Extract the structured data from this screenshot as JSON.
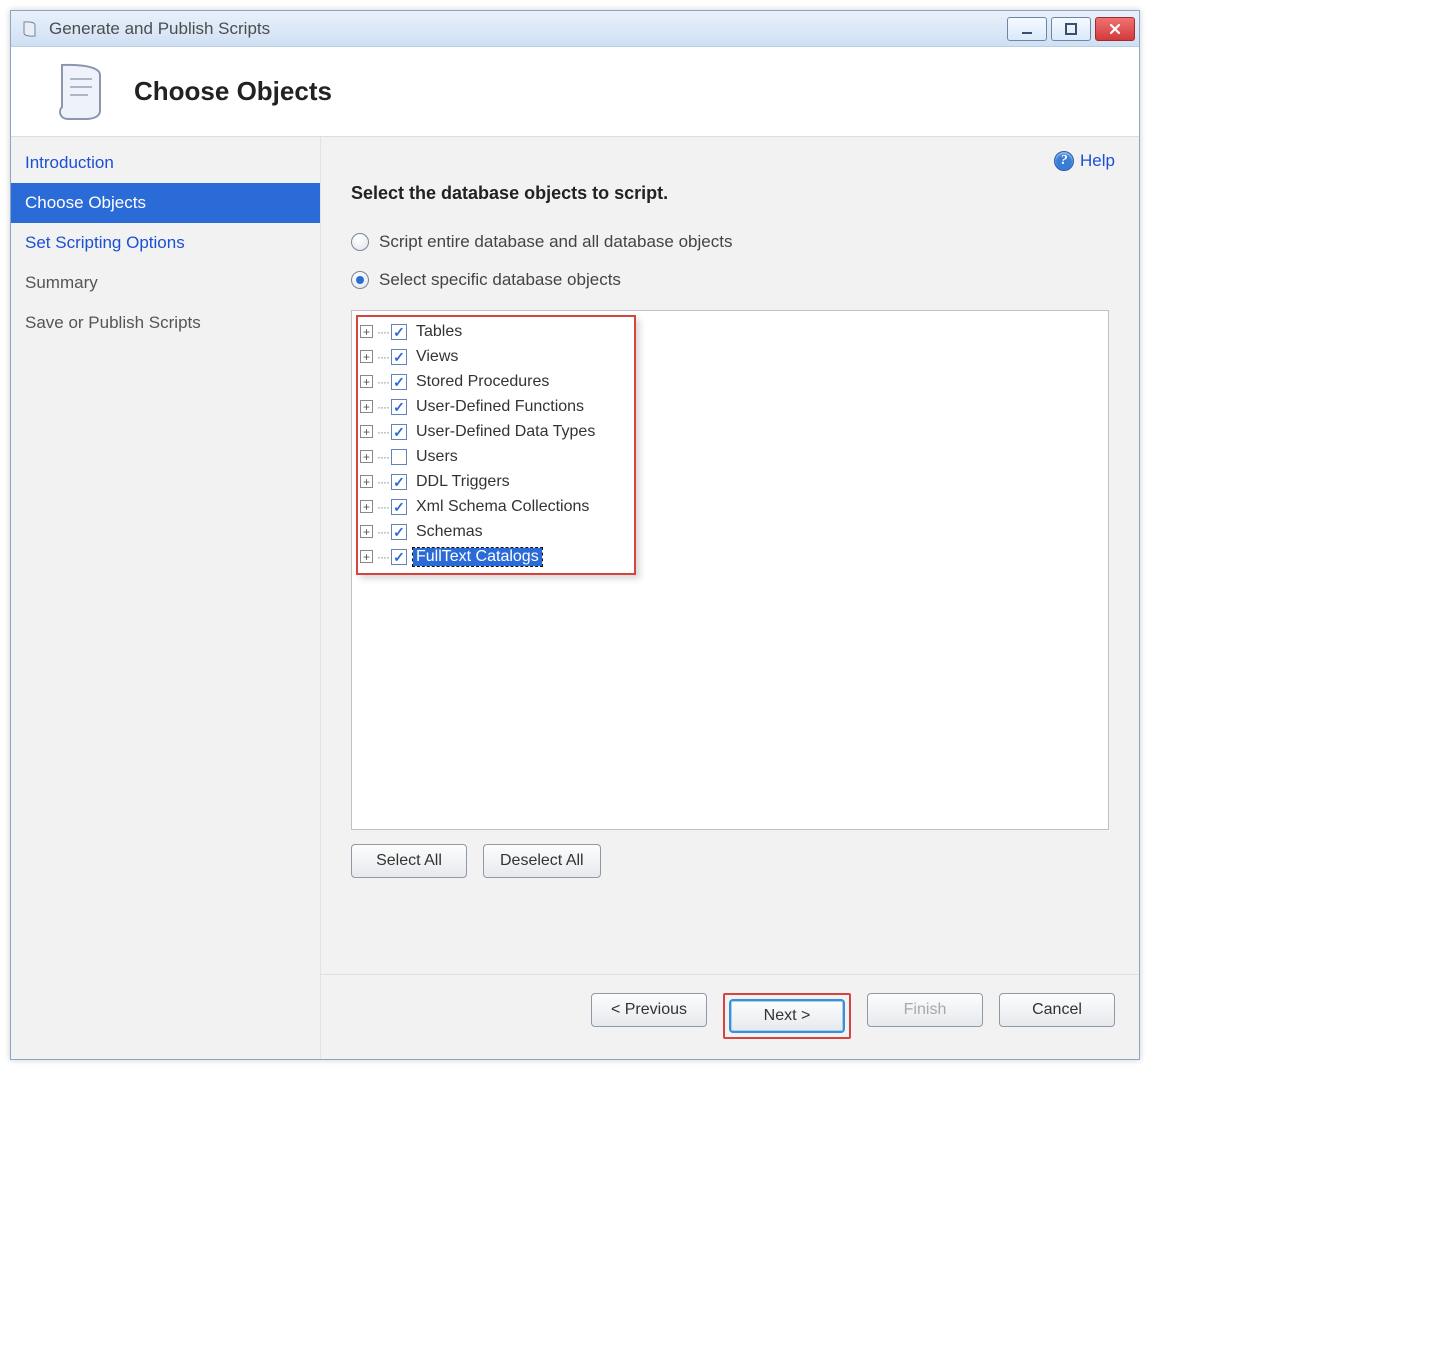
{
  "titlebar": {
    "title": "Generate and Publish Scripts"
  },
  "header": {
    "page_title": "Choose Objects"
  },
  "sidebar": {
    "items": [
      {
        "label": "Introduction",
        "active": false,
        "style": "link"
      },
      {
        "label": "Choose Objects",
        "active": true,
        "style": "active"
      },
      {
        "label": "Set Scripting Options",
        "active": false,
        "style": "link"
      },
      {
        "label": "Summary",
        "active": false,
        "style": "plain"
      },
      {
        "label": "Save or Publish Scripts",
        "active": false,
        "style": "plain"
      }
    ]
  },
  "main": {
    "help_label": "Help",
    "heading": "Select the database objects to script.",
    "radios": {
      "entire": {
        "label": "Script entire database and all database objects",
        "checked": false
      },
      "specific": {
        "label": "Select specific database objects",
        "checked": true
      }
    },
    "tree": [
      {
        "label": "Tables",
        "checked": true,
        "selected": false
      },
      {
        "label": "Views",
        "checked": true,
        "selected": false
      },
      {
        "label": "Stored Procedures",
        "checked": true,
        "selected": false
      },
      {
        "label": "User-Defined Functions",
        "checked": true,
        "selected": false
      },
      {
        "label": "User-Defined Data Types",
        "checked": true,
        "selected": false
      },
      {
        "label": "Users",
        "checked": false,
        "selected": false
      },
      {
        "label": "DDL Triggers",
        "checked": true,
        "selected": false
      },
      {
        "label": "Xml Schema Collections",
        "checked": true,
        "selected": false
      },
      {
        "label": "Schemas",
        "checked": true,
        "selected": false
      },
      {
        "label": "FullText Catalogs",
        "checked": true,
        "selected": true
      }
    ],
    "select_all": "Select All",
    "deselect_all": "Deselect All"
  },
  "footer": {
    "previous": "< Previous",
    "next": "Next >",
    "finish": "Finish",
    "cancel": "Cancel"
  }
}
